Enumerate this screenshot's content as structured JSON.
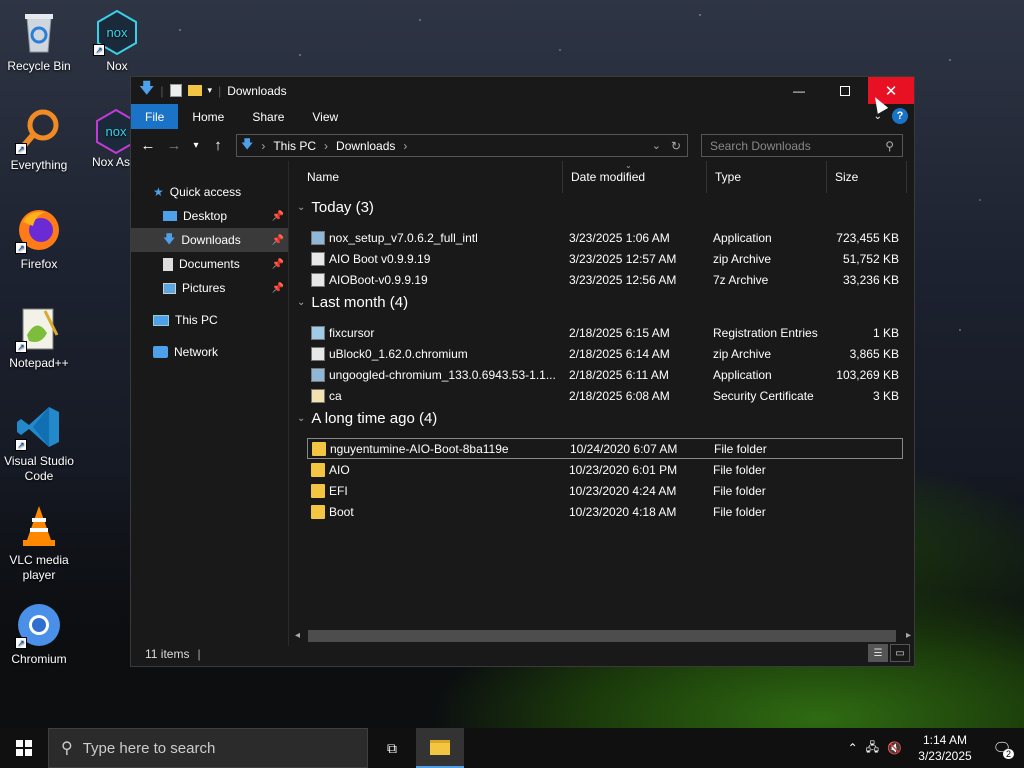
{
  "desktop_icons": [
    {
      "label": "Recycle Bin"
    },
    {
      "label": "Nox"
    },
    {
      "label": "Everything"
    },
    {
      "label": "Nox As"
    },
    {
      "label": "Firefox"
    },
    {
      "label": "Notepad++"
    },
    {
      "label": "Visual Studio Code"
    },
    {
      "label": "VLC media player"
    },
    {
      "label": "Chromium"
    }
  ],
  "window": {
    "title": "Downloads",
    "ribbon_tabs": [
      "File",
      "Home",
      "Share",
      "View"
    ],
    "address": {
      "segments": [
        "This PC",
        "Downloads"
      ]
    },
    "search": {
      "placeholder": "Search Downloads"
    },
    "nav": {
      "quick_access": "Quick access",
      "items": [
        {
          "label": "Desktop"
        },
        {
          "label": "Downloads"
        },
        {
          "label": "Documents"
        },
        {
          "label": "Pictures"
        }
      ],
      "this_pc": "This PC",
      "network": "Network"
    },
    "columns": {
      "name": "Name",
      "date": "Date modified",
      "type": "Type",
      "size": "Size"
    },
    "groups": [
      {
        "label": "Today (3)",
        "rows": [
          {
            "name": "nox_setup_v7.0.6.2_full_intl",
            "date": "3/23/2025 1:06 AM",
            "type": "Application",
            "size": "723,455 KB",
            "icon": "app-icon"
          },
          {
            "name": "AIO Boot v0.9.9.19",
            "date": "3/23/2025 12:57 AM",
            "type": "zip Archive",
            "size": "51,752 KB",
            "icon": "archive-icon"
          },
          {
            "name": "AIOBoot-v0.9.9.19",
            "date": "3/23/2025 12:56 AM",
            "type": "7z Archive",
            "size": "33,236 KB",
            "icon": "archive-icon"
          }
        ]
      },
      {
        "label": "Last month (4)",
        "rows": [
          {
            "name": "fixcursor",
            "date": "2/18/2025 6:15 AM",
            "type": "Registration Entries",
            "size": "1 KB",
            "icon": "registry-icon"
          },
          {
            "name": "uBlock0_1.62.0.chromium",
            "date": "2/18/2025 6:14 AM",
            "type": "zip Archive",
            "size": "3,865 KB",
            "icon": "archive-icon"
          },
          {
            "name": "ungoogled-chromium_133.0.6943.53-1.1...",
            "date": "2/18/2025 6:11 AM",
            "type": "Application",
            "size": "103,269 KB",
            "icon": "app-icon"
          },
          {
            "name": "ca",
            "date": "2/18/2025 6:08 AM",
            "type": "Security Certificate",
            "size": "3 KB",
            "icon": "certificate-icon"
          }
        ]
      },
      {
        "label": "A long time ago (4)",
        "rows": [
          {
            "name": "nguyentumine-AIO-Boot-8ba119e",
            "date": "10/24/2020 6:07 AM",
            "type": "File folder",
            "size": "",
            "icon": "folder-icon"
          },
          {
            "name": "AIO",
            "date": "10/23/2020 6:01 PM",
            "type": "File folder",
            "size": "",
            "icon": "folder-icon"
          },
          {
            "name": "EFI",
            "date": "10/23/2020 4:24 AM",
            "type": "File folder",
            "size": "",
            "icon": "folder-icon"
          },
          {
            "name": "Boot",
            "date": "10/23/2020 4:18 AM",
            "type": "File folder",
            "size": "",
            "icon": "folder-icon"
          }
        ]
      }
    ],
    "status": "11 items"
  },
  "taskbar": {
    "search_placeholder": "Type here to search",
    "time": "1:14 AM",
    "date": "3/23/2025",
    "notification_count": "2"
  },
  "colors": {
    "accent": "#1a73c7",
    "close": "#e81123",
    "folder": "#f4c542"
  }
}
